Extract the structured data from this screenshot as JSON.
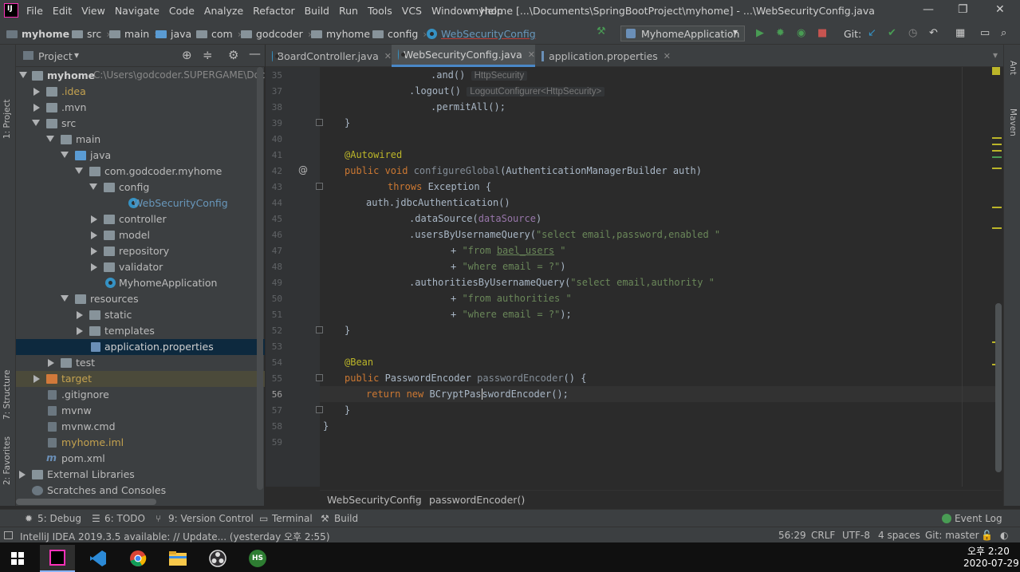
{
  "menubar": {
    "items": [
      "File",
      "Edit",
      "View",
      "Navigate",
      "Code",
      "Analyze",
      "Refactor",
      "Build",
      "Run",
      "Tools",
      "VCS",
      "Window",
      "Help"
    ],
    "title": "myhome [...\\Documents\\SpringBootProject\\myhome] - ...\\WebSecurityConfig.java"
  },
  "navbar": {
    "crumbs": [
      "myhome",
      "src",
      "main",
      "java",
      "com",
      "godcoder",
      "myhome",
      "config",
      "WebSecurityConfig"
    ],
    "run_config": "MyhomeApplication",
    "git_label": "Git:"
  },
  "side_labels": {
    "project": "1: Project",
    "structure": "7: Structure",
    "favorites": "2: Favorites",
    "ant": "Ant",
    "maven": "Maven"
  },
  "project": {
    "header": "Project",
    "root_name": "myhome",
    "root_path": "C:\\Users\\godcoder.SUPERGAME\\Doc",
    "tree": [
      {
        "label": ".idea",
        "color": "#c4a24f"
      },
      {
        "label": ".mvn",
        "color": "#bbbbbb"
      },
      {
        "label": "src",
        "color": "#bbbbbb"
      },
      {
        "label": "main",
        "color": "#bbbbbb"
      },
      {
        "label": "java",
        "color": "#bbbbbb"
      },
      {
        "label": "com.godcoder.myhome",
        "color": "#bbbbbb"
      },
      {
        "label": "config",
        "color": "#bbbbbb"
      },
      {
        "label": "WebSecurityConfig",
        "color": "#6897bb"
      },
      {
        "label": "controller",
        "color": "#bbbbbb"
      },
      {
        "label": "model",
        "color": "#bbbbbb"
      },
      {
        "label": "repository",
        "color": "#bbbbbb"
      },
      {
        "label": "validator",
        "color": "#bbbbbb"
      },
      {
        "label": "MyhomeApplication",
        "color": "#bbbbbb"
      },
      {
        "label": "resources",
        "color": "#bbbbbb"
      },
      {
        "label": "static",
        "color": "#bbbbbb"
      },
      {
        "label": "templates",
        "color": "#bbbbbb"
      },
      {
        "label": "application.properties",
        "color": "#bbbbbb"
      },
      {
        "label": "test",
        "color": "#bbbbbb"
      },
      {
        "label": "target",
        "color": "#c4a24f"
      },
      {
        "label": ".gitignore",
        "color": "#bbbbbb"
      },
      {
        "label": "mvnw",
        "color": "#bbbbbb"
      },
      {
        "label": "mvnw.cmd",
        "color": "#bbbbbb"
      },
      {
        "label": "myhome.iml",
        "color": "#c4a24f"
      },
      {
        "label": "pom.xml",
        "color": "#bbbbbb"
      },
      {
        "label": "External Libraries",
        "color": "#bbbbbb"
      },
      {
        "label": "Scratches and Consoles",
        "color": "#bbbbbb"
      }
    ]
  },
  "tabs": [
    "BoardController.java",
    "WebSecurityConfig.java",
    "application.properties"
  ],
  "editor": {
    "line_numbers": [
      "35",
      "37",
      "38",
      "39",
      "40",
      "41",
      "42",
      "43",
      "44",
      "45",
      "46",
      "47",
      "48",
      "49",
      "50",
      "51",
      "52",
      "53",
      "54",
      "55",
      "56",
      "57",
      "58",
      "59"
    ],
    "hint_http": "HttpSecurity",
    "hint_logout": "LogoutConfigurer<HttpSecurity>",
    "breadcrumb_class": "WebSecurityConfig",
    "breadcrumb_method": "passwordEncoder()"
  },
  "toolwindows": {
    "debug": "5: Debug",
    "todo": "6: TODO",
    "vcs": "9: Version Control",
    "terminal": "Terminal",
    "build": "Build",
    "eventlog": "Event Log"
  },
  "status": {
    "message": "IntelliJ IDEA 2019.3.5 available: // Update... (yesterday 오후 2:55)",
    "position": "56:29",
    "line_sep": "CRLF",
    "encoding": "UTF-8",
    "indent": "4 spaces",
    "branch": "Git: master"
  },
  "taskbar": {
    "time": "오후 2:20",
    "date": "2020-07-29",
    "hs_label": "HS"
  }
}
